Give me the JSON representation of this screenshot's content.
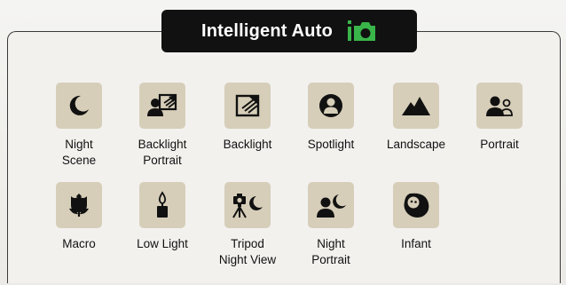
{
  "title": "Intelligent Auto",
  "colors": {
    "accent": "#39b54a",
    "tile": "#d6ceb9",
    "frame": "#3a3a3a",
    "title_bg": "#111111"
  },
  "modes": [
    {
      "label": "Night\nScene",
      "icon": "night-scene-icon"
    },
    {
      "label": "Backlight\nPortrait",
      "icon": "backlight-portrait-icon"
    },
    {
      "label": "Backlight",
      "icon": "backlight-icon"
    },
    {
      "label": "Spotlight",
      "icon": "spotlight-icon"
    },
    {
      "label": "Landscape",
      "icon": "landscape-icon"
    },
    {
      "label": "Portrait",
      "icon": "portrait-icon"
    },
    {
      "label": "Macro",
      "icon": "macro-icon"
    },
    {
      "label": "Low Light",
      "icon": "low-light-icon"
    },
    {
      "label": "Tripod\nNight View",
      "icon": "tripod-night-view-icon"
    },
    {
      "label": "Night\nPortrait",
      "icon": "night-portrait-icon"
    },
    {
      "label": "Infant",
      "icon": "infant-icon"
    }
  ]
}
